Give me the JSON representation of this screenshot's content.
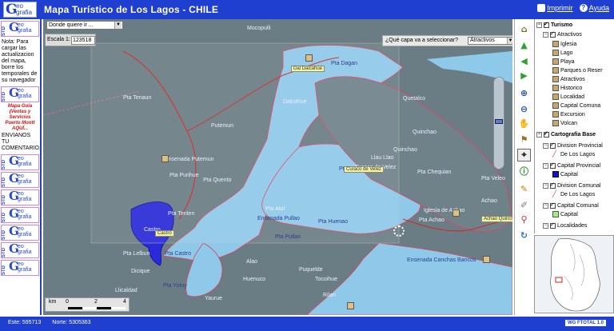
{
  "header": {
    "logo_big": "G",
    "logo_small": "eo grafia",
    "title": "Mapa Turístico de Los Lagos - CHILE",
    "print_label": "Imprimir",
    "help_label": "Ayuda"
  },
  "left": {
    "logo_std": "STD",
    "logo_g": "G",
    "logo_eo": "eo grafia",
    "note": "Nota: Para cargar las actualizacion del mapa, borre los temporales de su navegador",
    "guide": "Mapa Guía (Ventas y Servicios Puerto Montt AQUÍ...",
    "invite": "ENVIANOS TU COMENTARIO."
  },
  "map": {
    "where_select": "Donde quiere ir ...",
    "scale_label": "Escala 1:",
    "scale_value": "123518",
    "layer_question": "¿Qué capa va a seleccionar?",
    "layer_selected": "Atractivos",
    "scalebar_unit": "km",
    "scalebar_ticks": [
      "0",
      "2",
      "4"
    ],
    "labels": [
      {
        "text": "Pta Dagan",
        "cls": "dark"
      },
      {
        "text": "Ensenada Pullao",
        "cls": "dark"
      },
      {
        "text": "Pta Pullao",
        "cls": "dark"
      },
      {
        "text": "Pta Huenao",
        "cls": "dark"
      },
      {
        "text": "Pta Cur",
        "cls": "dark"
      },
      {
        "text": "Ensenada Canchas Bancos",
        "cls": "dark"
      },
      {
        "text": "Pta Yutuy",
        "cls": "dark"
      },
      {
        "text": "Pta Castro",
        "cls": "dark"
      },
      {
        "text": "Ensenada Putemun",
        "cls": ""
      },
      {
        "text": "Pta Purihue",
        "cls": ""
      },
      {
        "text": "Pta Quento",
        "cls": ""
      },
      {
        "text": "Pta Tenten",
        "cls": ""
      },
      {
        "text": "Tocoihue",
        "cls": ""
      },
      {
        "text": "Quetalco",
        "cls": ""
      },
      {
        "text": "Llicaldad",
        "cls": ""
      },
      {
        "text": "Castro",
        "cls": ""
      },
      {
        "text": "Pta Atal",
        "cls": ""
      },
      {
        "text": "Dalcahue",
        "cls": ""
      },
      {
        "text": "Quinchao",
        "cls": ""
      },
      {
        "text": "Pta Chequian",
        "cls": ""
      },
      {
        "text": "Pta Veleo",
        "cls": ""
      },
      {
        "text": "Quinchao",
        "cls": ""
      },
      {
        "text": "Curaco de Velez",
        "cls": ""
      },
      {
        "text": "Achao",
        "cls": ""
      },
      {
        "text": "Putemun",
        "cls": ""
      },
      {
        "text": "Mocopulli",
        "cls": ""
      },
      {
        "text": "Pta Tenaun",
        "cls": ""
      },
      {
        "text": "Rilan",
        "cls": ""
      },
      {
        "text": "Dicique",
        "cls": ""
      },
      {
        "text": "Pta Achao",
        "cls": ""
      },
      {
        "text": "Puquelde",
        "cls": ""
      },
      {
        "text": "Yaurue",
        "cls": ""
      },
      {
        "text": "Alao",
        "cls": ""
      },
      {
        "text": "Iglesia de Achao",
        "cls": ""
      },
      {
        "text": "Llau Llao",
        "cls": ""
      },
      {
        "text": "Huenuco",
        "cls": ""
      },
      {
        "text": "Pta Lelbun",
        "cls": ""
      }
    ],
    "tags": [
      {
        "text": "Dal Dalcahue"
      },
      {
        "text": "Castro"
      },
      {
        "text": "Curaco de Velez"
      },
      {
        "text": "Achao Quinchao"
      }
    ]
  },
  "tools": [
    "home-icon",
    "arrow-up-icon",
    "arrow-left-icon",
    "arrow-right-icon",
    "zoom-in-icon",
    "zoom-out-icon",
    "pan-hand-icon",
    "select-icon",
    "identify-icon",
    "info-icon",
    "measure-icon",
    "draw-icon",
    "pin-icon",
    "refresh-icon"
  ],
  "panel": {
    "turismo": "Turismo",
    "atractivos": "Atractivos",
    "items": [
      "Iglesia",
      "Lago",
      "Playa",
      "Parques o Reser",
      "Atractivos",
      "Historico",
      "Localidad",
      "Capital Comuna",
      "Excursion",
      "Volcan"
    ],
    "carto": "Cartografia Base",
    "div_prov": "Division Provincial",
    "div_prov_item": "De Los Lagos",
    "cap_prov": "Capital Provincial",
    "cap_prov_item": "Capital",
    "div_com": "Division Comunal",
    "div_com_item": "De Los Lagos",
    "cap_com": "Capital Comunal",
    "cap_com_item": "Capital",
    "localidades": "Localidades"
  },
  "status": {
    "este": "Este: 595713",
    "norte": "Norte: 5305363",
    "badge": "WG FTOTAL 1.0"
  }
}
